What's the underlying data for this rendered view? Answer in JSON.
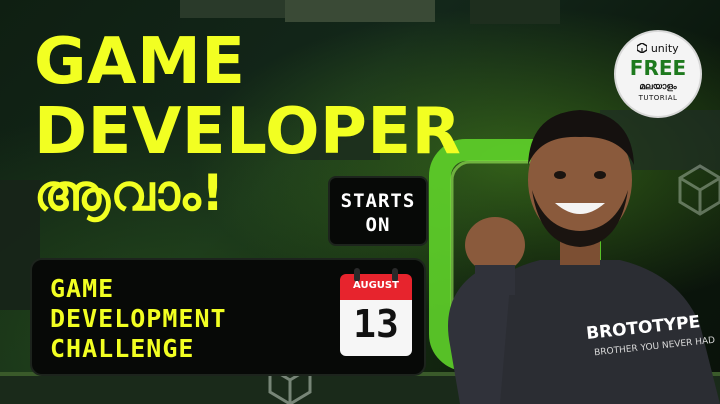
{
  "headline": {
    "line1": "GAME",
    "line2": "DEVELOPER",
    "line3": "ആവാം!"
  },
  "starts": {
    "line1": "STARTS",
    "line2": "ON"
  },
  "challenge": {
    "line1": "GAME",
    "line2": "DEVELOPMENT",
    "line3": "CHALLENGE"
  },
  "calendar": {
    "month": "AUGUST",
    "day": "13"
  },
  "badge": {
    "brand": "unity",
    "label": "FREE",
    "language": "മലയാളം",
    "tutorial": "TUTORIAL"
  },
  "shirt": {
    "brand": "BROTOTYPE",
    "tagline": "BROTHER YOU NEVER HAD"
  },
  "colors": {
    "headline": "#f2ff22",
    "background": "#0b120b",
    "accent_green": "#5fd12a",
    "calendar_red": "#e7242d",
    "hoodie": "#2b2d33"
  },
  "icons": [
    "unity-logo-icon",
    "calendar-icon",
    "unity-cube-watermark-icon"
  ]
}
